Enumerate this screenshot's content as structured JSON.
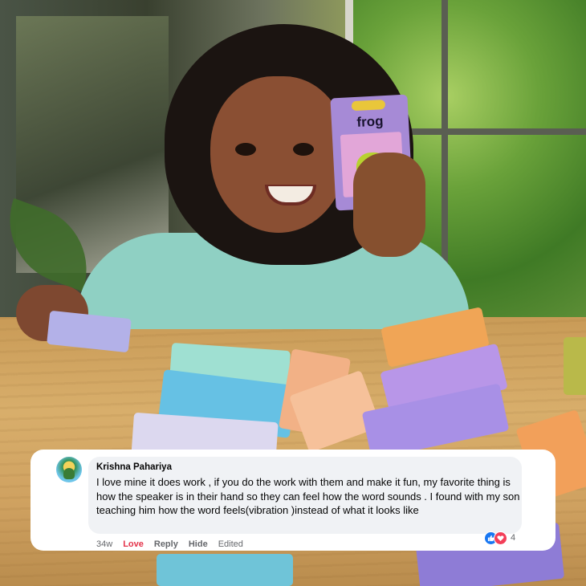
{
  "flash_card": {
    "word": "frog"
  },
  "comment": {
    "author": "Krishna Pahariya",
    "text": "I love mine it does work , if you do the work with them and make it fun, my favorite thing is how the speaker is in their hand so they can feel how the word sounds . I found with my son teaching him how the word feels(vibration )instead of what it looks like",
    "time": "34w",
    "reaction_label": "Love",
    "reply_label": "Reply",
    "hide_label": "Hide",
    "edited_label": "Edited",
    "reaction_count": "4",
    "reaction_icons": [
      "like-icon",
      "heart-icon"
    ]
  },
  "colors": {
    "bubble_bg": "#f0f2f5",
    "love_color": "#e4334a",
    "like_blue": "#1877f2",
    "heart_red": "#f33e58",
    "meta_gray": "#65676b"
  }
}
